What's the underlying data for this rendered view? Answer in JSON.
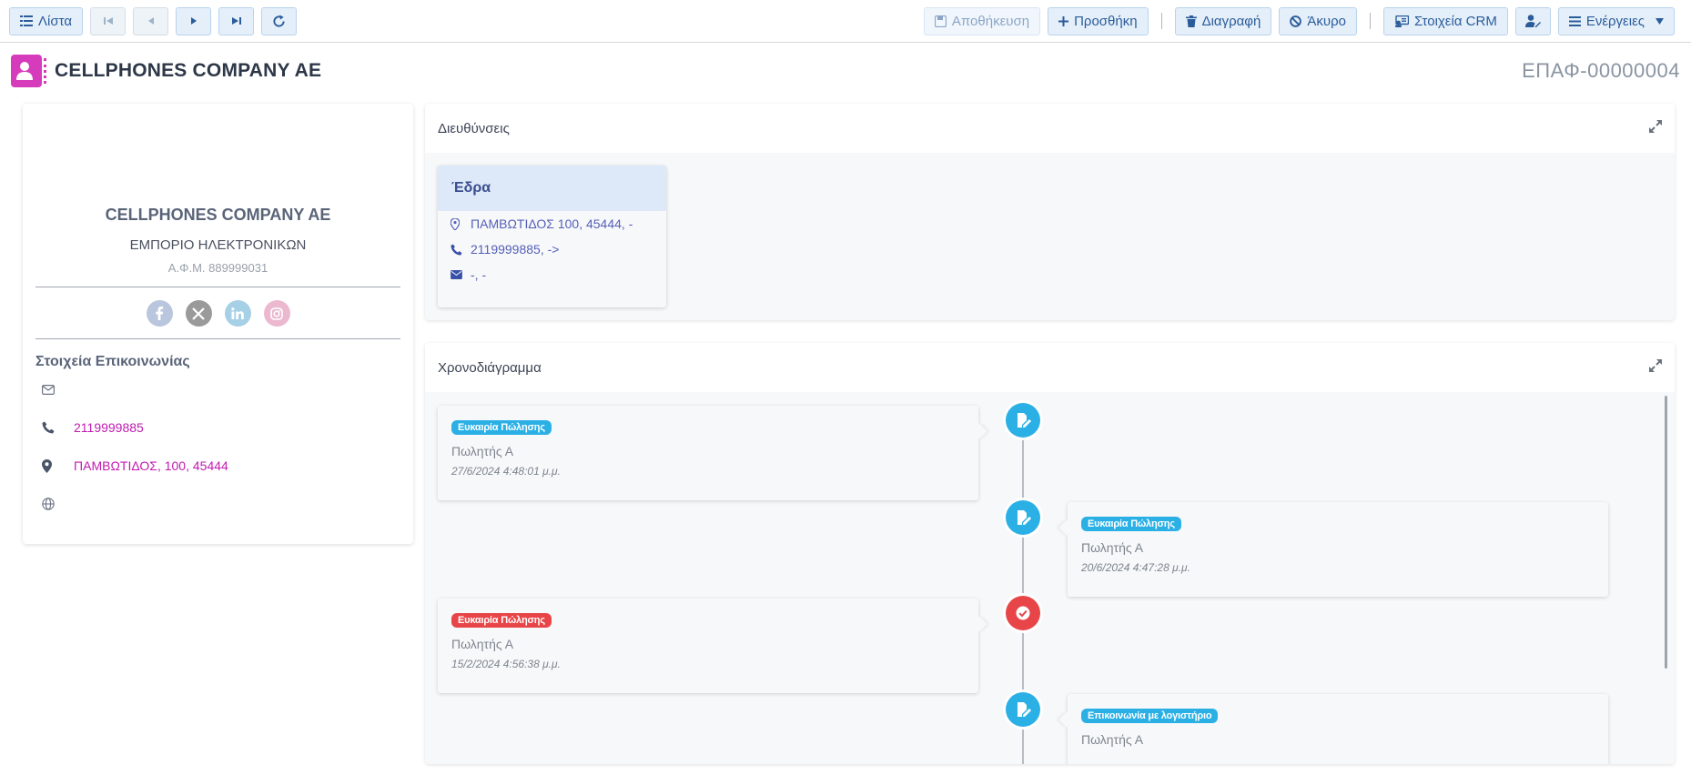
{
  "toolbar": {
    "list_label": "Λίστα",
    "save_label": "Αποθήκευση",
    "add_label": "Προσθήκη",
    "delete_label": "Διαγραφή",
    "cancel_label": "Άκυρο",
    "crm_label": "Στοιχεία CRM",
    "actions_label": "Ενέργειες"
  },
  "header": {
    "title": "CELLPHONES COMPANY AE",
    "record_code": "ΕΠΑΦ-00000004"
  },
  "profile": {
    "name": "CELLPHONES COMPANY AE",
    "subtitle": "ΕΜΠΟΡΙΟ ΗΛΕΚΤΡΟΝΙΚΩΝ",
    "vat": "Α.Φ.Μ. 889999031",
    "social_icons": [
      "facebook-icon",
      "x-icon",
      "linkedin-icon",
      "instagram-icon"
    ],
    "contact_section_label": "Στοιχεία Επικοινωνίας",
    "email": "",
    "phone": "2119999885",
    "address": "ΠΑΜΒΩΤΙΔΟΣ, 100, 45444",
    "website": ""
  },
  "addresses": {
    "panel_title": "Διευθύνσεις",
    "cards": [
      {
        "title": "Έδρα",
        "address": "ΠΑΜΒΩΤΙΔΟΣ 100, 45444, -",
        "phone": "2119999885, ->",
        "email": "-, -"
      }
    ]
  },
  "timeline": {
    "panel_title": "Χρονοδιάγραμμα",
    "items": [
      {
        "badge": "Ευκαιρία Πώλησης",
        "badge_color": "#2bb0e6",
        "user": "Πωλητής Α",
        "date": "27/6/2024 4:48:01 μ.μ.",
        "side": "left",
        "icon": "edit-document-icon"
      },
      {
        "badge": "Ευκαιρία Πώλησης",
        "badge_color": "#2bb0e6",
        "user": "Πωλητής Α",
        "date": "20/6/2024 4:47:28 μ.μ.",
        "side": "right",
        "icon": "edit-document-icon"
      },
      {
        "badge": "Ευκαιρία Πώλησης",
        "badge_color": "#e84548",
        "user": "Πωλητής Α",
        "date": "15/2/2024 4:56:38 μ.μ.",
        "side": "left",
        "icon": "check-circle-icon"
      },
      {
        "badge": "Επικοινωνία με λογιστήριο",
        "badge_color": "#2bb0e6",
        "user": "Πωλητής Α",
        "date": "",
        "side": "right",
        "icon": "edit-document-icon"
      }
    ]
  },
  "colors": {
    "accent": "#2b5c9a",
    "brand_magenta": "#d63bbc",
    "timeline_blue": "#2bb0e6",
    "timeline_red": "#e84548"
  }
}
